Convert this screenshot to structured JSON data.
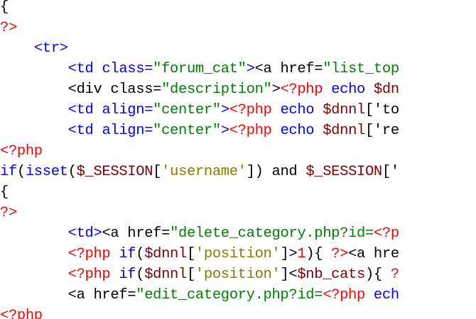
{
  "editor": {
    "lines": [
      {
        "tokens": [
          {
            "t": "{",
            "k": "default"
          }
        ]
      },
      {
        "tokens": [
          {
            "t": "?>",
            "k": "php"
          }
        ]
      },
      {
        "tokens": [
          {
            "t": "    ",
            "k": "default"
          },
          {
            "t": "<tr>",
            "k": "tag"
          }
        ]
      },
      {
        "tokens": [
          {
            "t": "        ",
            "k": "default"
          },
          {
            "t": "<td ",
            "k": "tag"
          },
          {
            "t": "class=",
            "k": "attr"
          },
          {
            "t": "\"forum_cat\"",
            "k": "string"
          },
          {
            "t": ">",
            "k": "tag"
          },
          {
            "t": "<a href=",
            "k": "default"
          },
          {
            "t": "\"list_top",
            "k": "string"
          }
        ]
      },
      {
        "tokens": [
          {
            "t": "        ",
            "k": "default"
          },
          {
            "t": "<div class=",
            "k": "default"
          },
          {
            "t": "\"description\"",
            "k": "string"
          },
          {
            "t": ">",
            "k": "default"
          },
          {
            "t": "<?php",
            "k": "php"
          },
          {
            "t": " ",
            "k": "default"
          },
          {
            "t": "echo",
            "k": "keyword"
          },
          {
            "t": " ",
            "k": "default"
          },
          {
            "t": "$dn",
            "k": "var"
          }
        ]
      },
      {
        "tokens": [
          {
            "t": "        ",
            "k": "default"
          },
          {
            "t": "<td ",
            "k": "tag"
          },
          {
            "t": "align=",
            "k": "attr"
          },
          {
            "t": "\"center\"",
            "k": "string"
          },
          {
            "t": ">",
            "k": "tag"
          },
          {
            "t": "<?php",
            "k": "php"
          },
          {
            "t": " ",
            "k": "default"
          },
          {
            "t": "echo",
            "k": "keyword"
          },
          {
            "t": " ",
            "k": "default"
          },
          {
            "t": "$dnnl",
            "k": "var"
          },
          {
            "t": "['to",
            "k": "default"
          }
        ]
      },
      {
        "tokens": [
          {
            "t": "        ",
            "k": "default"
          },
          {
            "t": "<td ",
            "k": "tag"
          },
          {
            "t": "align=",
            "k": "attr"
          },
          {
            "t": "\"center\"",
            "k": "string"
          },
          {
            "t": ">",
            "k": "tag"
          },
          {
            "t": "<?php",
            "k": "php"
          },
          {
            "t": " ",
            "k": "default"
          },
          {
            "t": "echo",
            "k": "keyword"
          },
          {
            "t": " ",
            "k": "default"
          },
          {
            "t": "$dnnl",
            "k": "var"
          },
          {
            "t": "['re",
            "k": "default"
          }
        ]
      },
      {
        "tokens": [
          {
            "t": "<?php",
            "k": "php"
          }
        ]
      },
      {
        "tokens": [
          {
            "t": "if",
            "k": "keyword"
          },
          {
            "t": "(",
            "k": "default"
          },
          {
            "t": "isset",
            "k": "keyword"
          },
          {
            "t": "(",
            "k": "default"
          },
          {
            "t": "$_SESSION",
            "k": "var"
          },
          {
            "t": "[",
            "k": "default"
          },
          {
            "t": "'username'",
            "k": "fstring"
          },
          {
            "t": "]) ",
            "k": "default"
          },
          {
            "t": "and",
            "k": "default"
          },
          {
            "t": " ",
            "k": "default"
          },
          {
            "t": "$_SESSION",
            "k": "var"
          },
          {
            "t": "['",
            "k": "default"
          }
        ]
      },
      {
        "tokens": [
          {
            "t": "{",
            "k": "default"
          }
        ]
      },
      {
        "tokens": [
          {
            "t": "?>",
            "k": "php"
          }
        ]
      },
      {
        "tokens": [
          {
            "t": "        ",
            "k": "default"
          },
          {
            "t": "<td>",
            "k": "tag"
          },
          {
            "t": "<a href=",
            "k": "default"
          },
          {
            "t": "\"delete_category.php?id=",
            "k": "string"
          },
          {
            "t": "<?p",
            "k": "php"
          }
        ]
      },
      {
        "tokens": [
          {
            "t": "        ",
            "k": "default"
          },
          {
            "t": "<?php",
            "k": "php"
          },
          {
            "t": " ",
            "k": "default"
          },
          {
            "t": "if",
            "k": "keyword"
          },
          {
            "t": "(",
            "k": "default"
          },
          {
            "t": "$dnnl",
            "k": "var"
          },
          {
            "t": "[",
            "k": "default"
          },
          {
            "t": "'position'",
            "k": "fstring"
          },
          {
            "t": "]>",
            "k": "default"
          },
          {
            "t": "1",
            "k": "php"
          },
          {
            "t": "){ ",
            "k": "default"
          },
          {
            "t": "?>",
            "k": "php"
          },
          {
            "t": "<a hre",
            "k": "default"
          }
        ]
      },
      {
        "tokens": [
          {
            "t": "        ",
            "k": "default"
          },
          {
            "t": "<?php",
            "k": "php"
          },
          {
            "t": " ",
            "k": "default"
          },
          {
            "t": "if",
            "k": "keyword"
          },
          {
            "t": "(",
            "k": "default"
          },
          {
            "t": "$dnnl",
            "k": "var"
          },
          {
            "t": "[",
            "k": "default"
          },
          {
            "t": "'position'",
            "k": "fstring"
          },
          {
            "t": "]<",
            "k": "default"
          },
          {
            "t": "$nb_cats",
            "k": "var"
          },
          {
            "t": "){ ",
            "k": "default"
          },
          {
            "t": "?",
            "k": "php"
          }
        ]
      },
      {
        "tokens": [
          {
            "t": "        ",
            "k": "default"
          },
          {
            "t": "<a href=",
            "k": "default"
          },
          {
            "t": "\"edit_category.php?id=",
            "k": "string"
          },
          {
            "t": "<?php",
            "k": "php"
          },
          {
            "t": " ",
            "k": "default"
          },
          {
            "t": "ech",
            "k": "keyword"
          }
        ]
      },
      {
        "tokens": [
          {
            "t": "<?php",
            "k": "php"
          }
        ]
      }
    ]
  }
}
